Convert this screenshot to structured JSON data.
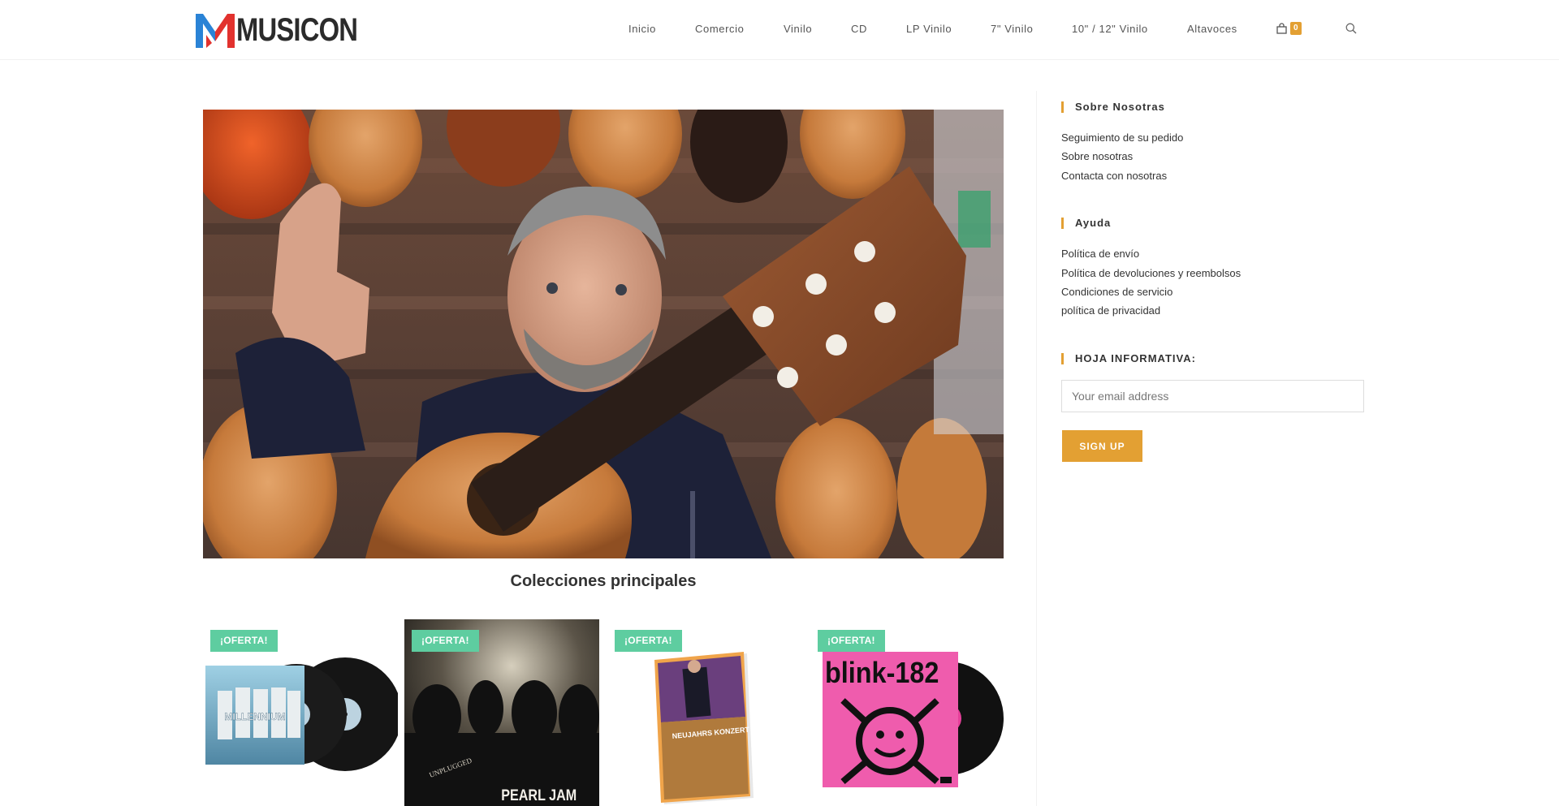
{
  "brand": {
    "name": "MUSICON"
  },
  "nav": {
    "items": [
      {
        "label": "Inicio"
      },
      {
        "label": "Comercio"
      },
      {
        "label": "Vinilo"
      },
      {
        "label": "CD"
      },
      {
        "label": "LP Vinilo"
      },
      {
        "label": "7\" Vinilo"
      },
      {
        "label": "10\" / 12\" Vinilo"
      },
      {
        "label": "Altavoces"
      }
    ],
    "cart_count": "0",
    "cart_icon": "shopping-bag-icon",
    "search_icon": "search-icon"
  },
  "main": {
    "section_title": "Colecciones principales",
    "products": [
      {
        "badge": "¡OFERTA!",
        "cover_text": "MILLENNIUM"
      },
      {
        "badge": "¡OFERTA!",
        "cover_text": "PEARL JAM",
        "cover_subtext": "UNPLUGGED"
      },
      {
        "badge": "¡OFERTA!",
        "cover_text": "NEUJAHRS KONZERT 2024"
      },
      {
        "badge": "¡OFERTA!",
        "cover_text": "blink-182"
      }
    ]
  },
  "sidebar": {
    "about": {
      "title": "Sobre Nosotras",
      "links": [
        "Seguimiento de su pedido",
        "Sobre nosotras",
        "Contacta con nosotras"
      ]
    },
    "help": {
      "title": "Ayuda",
      "links": [
        "Política de envío",
        "Política de devoluciones y reembolsos",
        "Condiciones de servicio",
        "política de privacidad"
      ]
    },
    "newsletter": {
      "title": "HOJA INFORMATIVA:",
      "placeholder": "Your email address",
      "button": "SIGN UP"
    }
  },
  "colors": {
    "accent": "#e3a033",
    "sale_badge": "#5ecda0",
    "text": "#333333"
  }
}
